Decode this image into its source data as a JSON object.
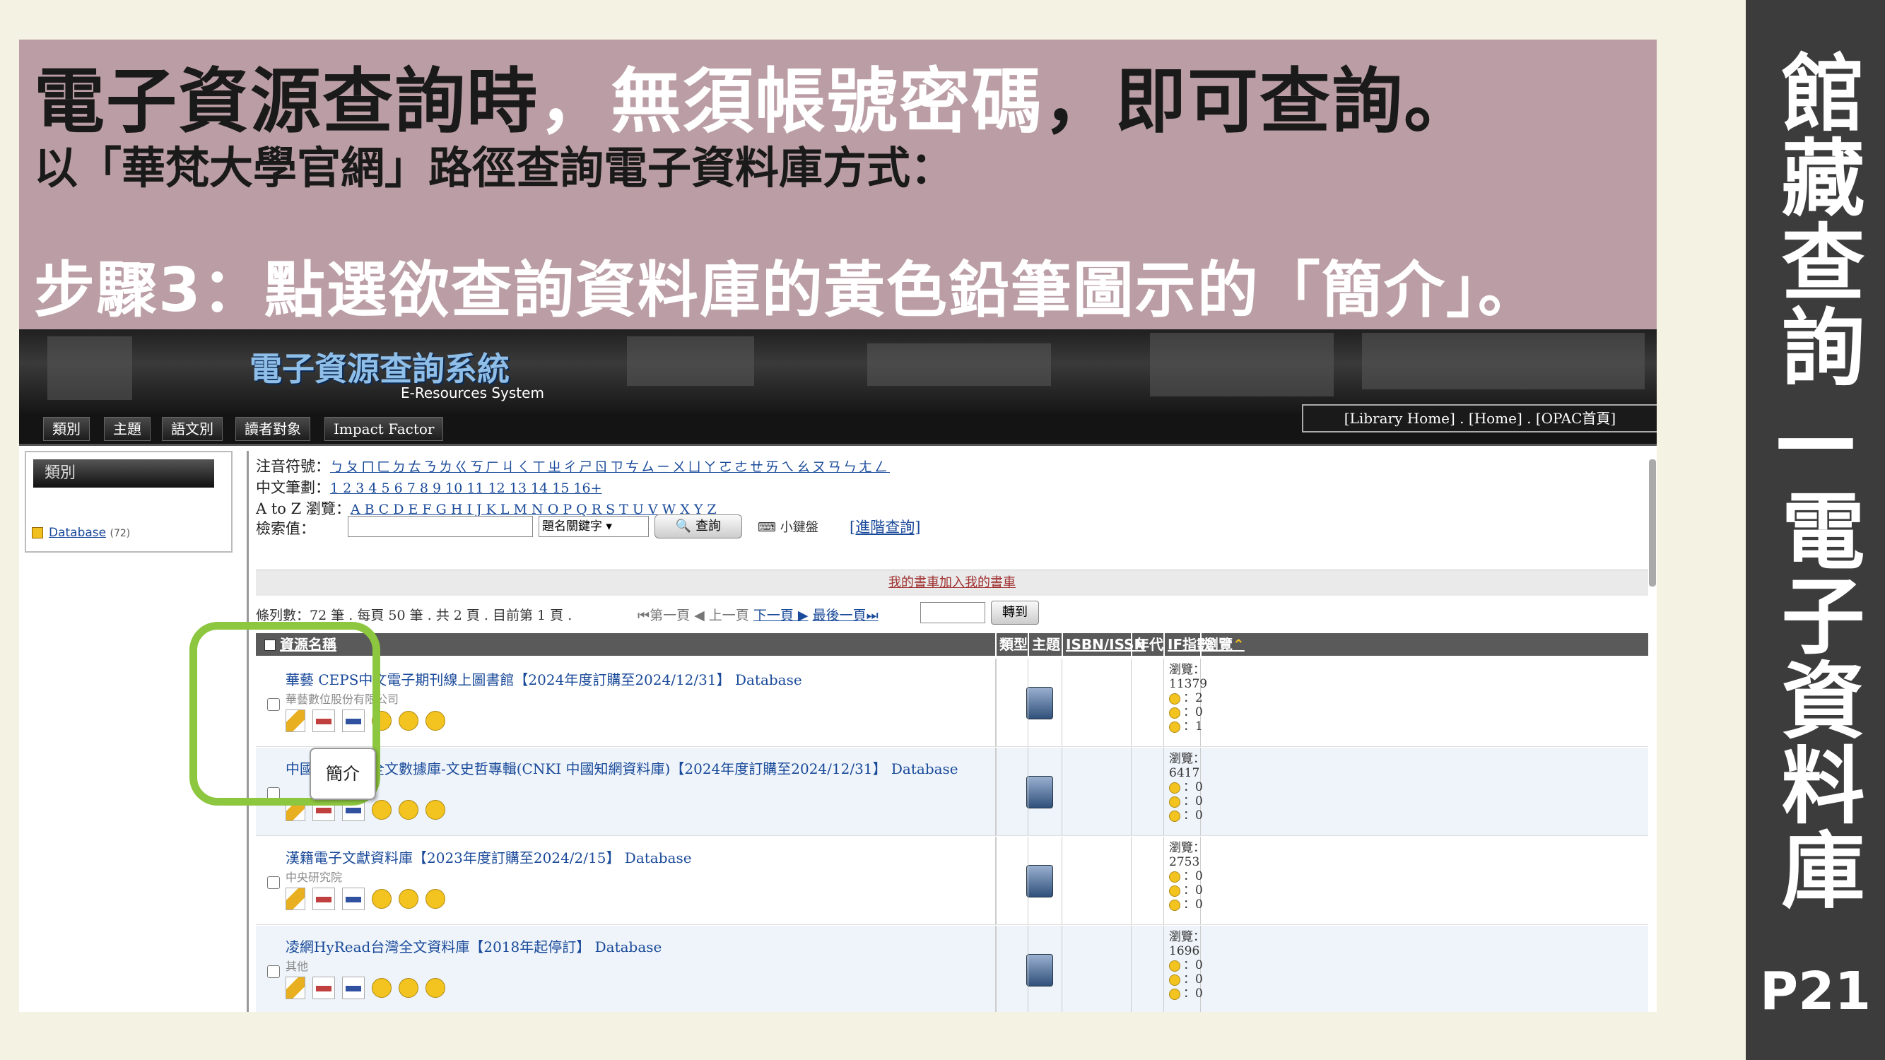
{
  "slide": {
    "title_black_1": "電子資源查詢時",
    "title_white": "，無須帳號密碼",
    "title_black_2": "，即可查詢。",
    "subtitle": "以「華梵大學官網」路徑查詢電子資料庫方式：",
    "step": "步驟3：點選欲查詢資料庫的黃色鉛筆圖示的「簡介」。",
    "side_title": "館藏查詢—電子資料庫",
    "page_number": "P21",
    "highlight_color": "#8dc63f",
    "banner_color": "#bb9ea5"
  },
  "system": {
    "name": "電子資源查詢系統",
    "name_en": "E-Resources System",
    "menu": [
      "類別",
      "主題",
      "語文別",
      "讀者對象",
      "Impact Factor"
    ],
    "top_links": "[Library Home] . [Home] . [OPAC首頁]"
  },
  "left_panel": {
    "heading": "類別",
    "item_label": "Database",
    "item_count": "(72)"
  },
  "search": {
    "zhuyin_label": "注音符號：",
    "zhuyin_links": "ㄅㄆㄇㄈㄉㄊㄋㄌㄍㄎㄏㄐㄑㄒㄓㄔㄕㄖㄗㄘㄙㄧㄨㄩㄚㄛㄜㄝㄞㄟㄠㄡㄢㄣㄤㄥ",
    "strokes_label": "中文筆劃：",
    "strokes_links": "1 2 3 4 5 6 7 8 9 10 11 12 13 14 15 16+",
    "az_label": "A to Z 瀏覽：",
    "az_links": "A B C D E F G H I J K L M N O P Q R S T U V W X Y Z",
    "value_label": "檢索值：",
    "select_value": "題名關鍵字",
    "button": "查詢",
    "keyboard": "小鍵盤",
    "advanced": "[進階查詢]"
  },
  "list": {
    "my_shelf": "我的書車加入我的書車",
    "status": "條列數：72 筆 . 每頁 50 筆 . 共 2 頁 . 目前第 1 頁 .",
    "pager_first": "⏮第一頁",
    "pager_prev": "◀ 上一頁",
    "pager_next": "下一頁 ▶",
    "pager_last": "最後一頁⏭",
    "goto": "轉到",
    "columns": [
      "資源名稱",
      "類型",
      "主題",
      "ISBN/ISSN",
      "年代",
      "IF指數",
      "瀏覽"
    ],
    "rows": [
      {
        "title": "華藝 CEPS中文電子期刊線上圖書館【2024年度訂購至2024/12/31】 Database",
        "publisher": "華藝數位股份有限公司",
        "views_label": "瀏覽：",
        "views": "11379",
        "r1": "：2",
        "r2": "：0",
        "r3": "：1"
      },
      {
        "title": "中國學術期刊全文數據庫-文史哲專輯(CNKI 中國知網資料庫)【2024年度訂購至2024/12/31】 Database",
        "publisher": "",
        "views_label": "瀏覽：",
        "views": "6417",
        "r1": "：0",
        "r2": "：0",
        "r3": "：0"
      },
      {
        "title": "漢籍電子文獻資料庫【2023年度訂購至2024/2/15】 Database",
        "publisher": "中央研究院",
        "views_label": "瀏覽：",
        "views": "2753",
        "r1": "：0",
        "r2": "：0",
        "r3": "：0"
      },
      {
        "title": "凌網HyRead台灣全文資料庫【2018年起停訂】 Database",
        "publisher": "其他",
        "views_label": "瀏覽：",
        "views": "1696",
        "r1": "：0",
        "r2": "：0",
        "r3": "：0"
      }
    ],
    "tooltip": "簡介"
  }
}
